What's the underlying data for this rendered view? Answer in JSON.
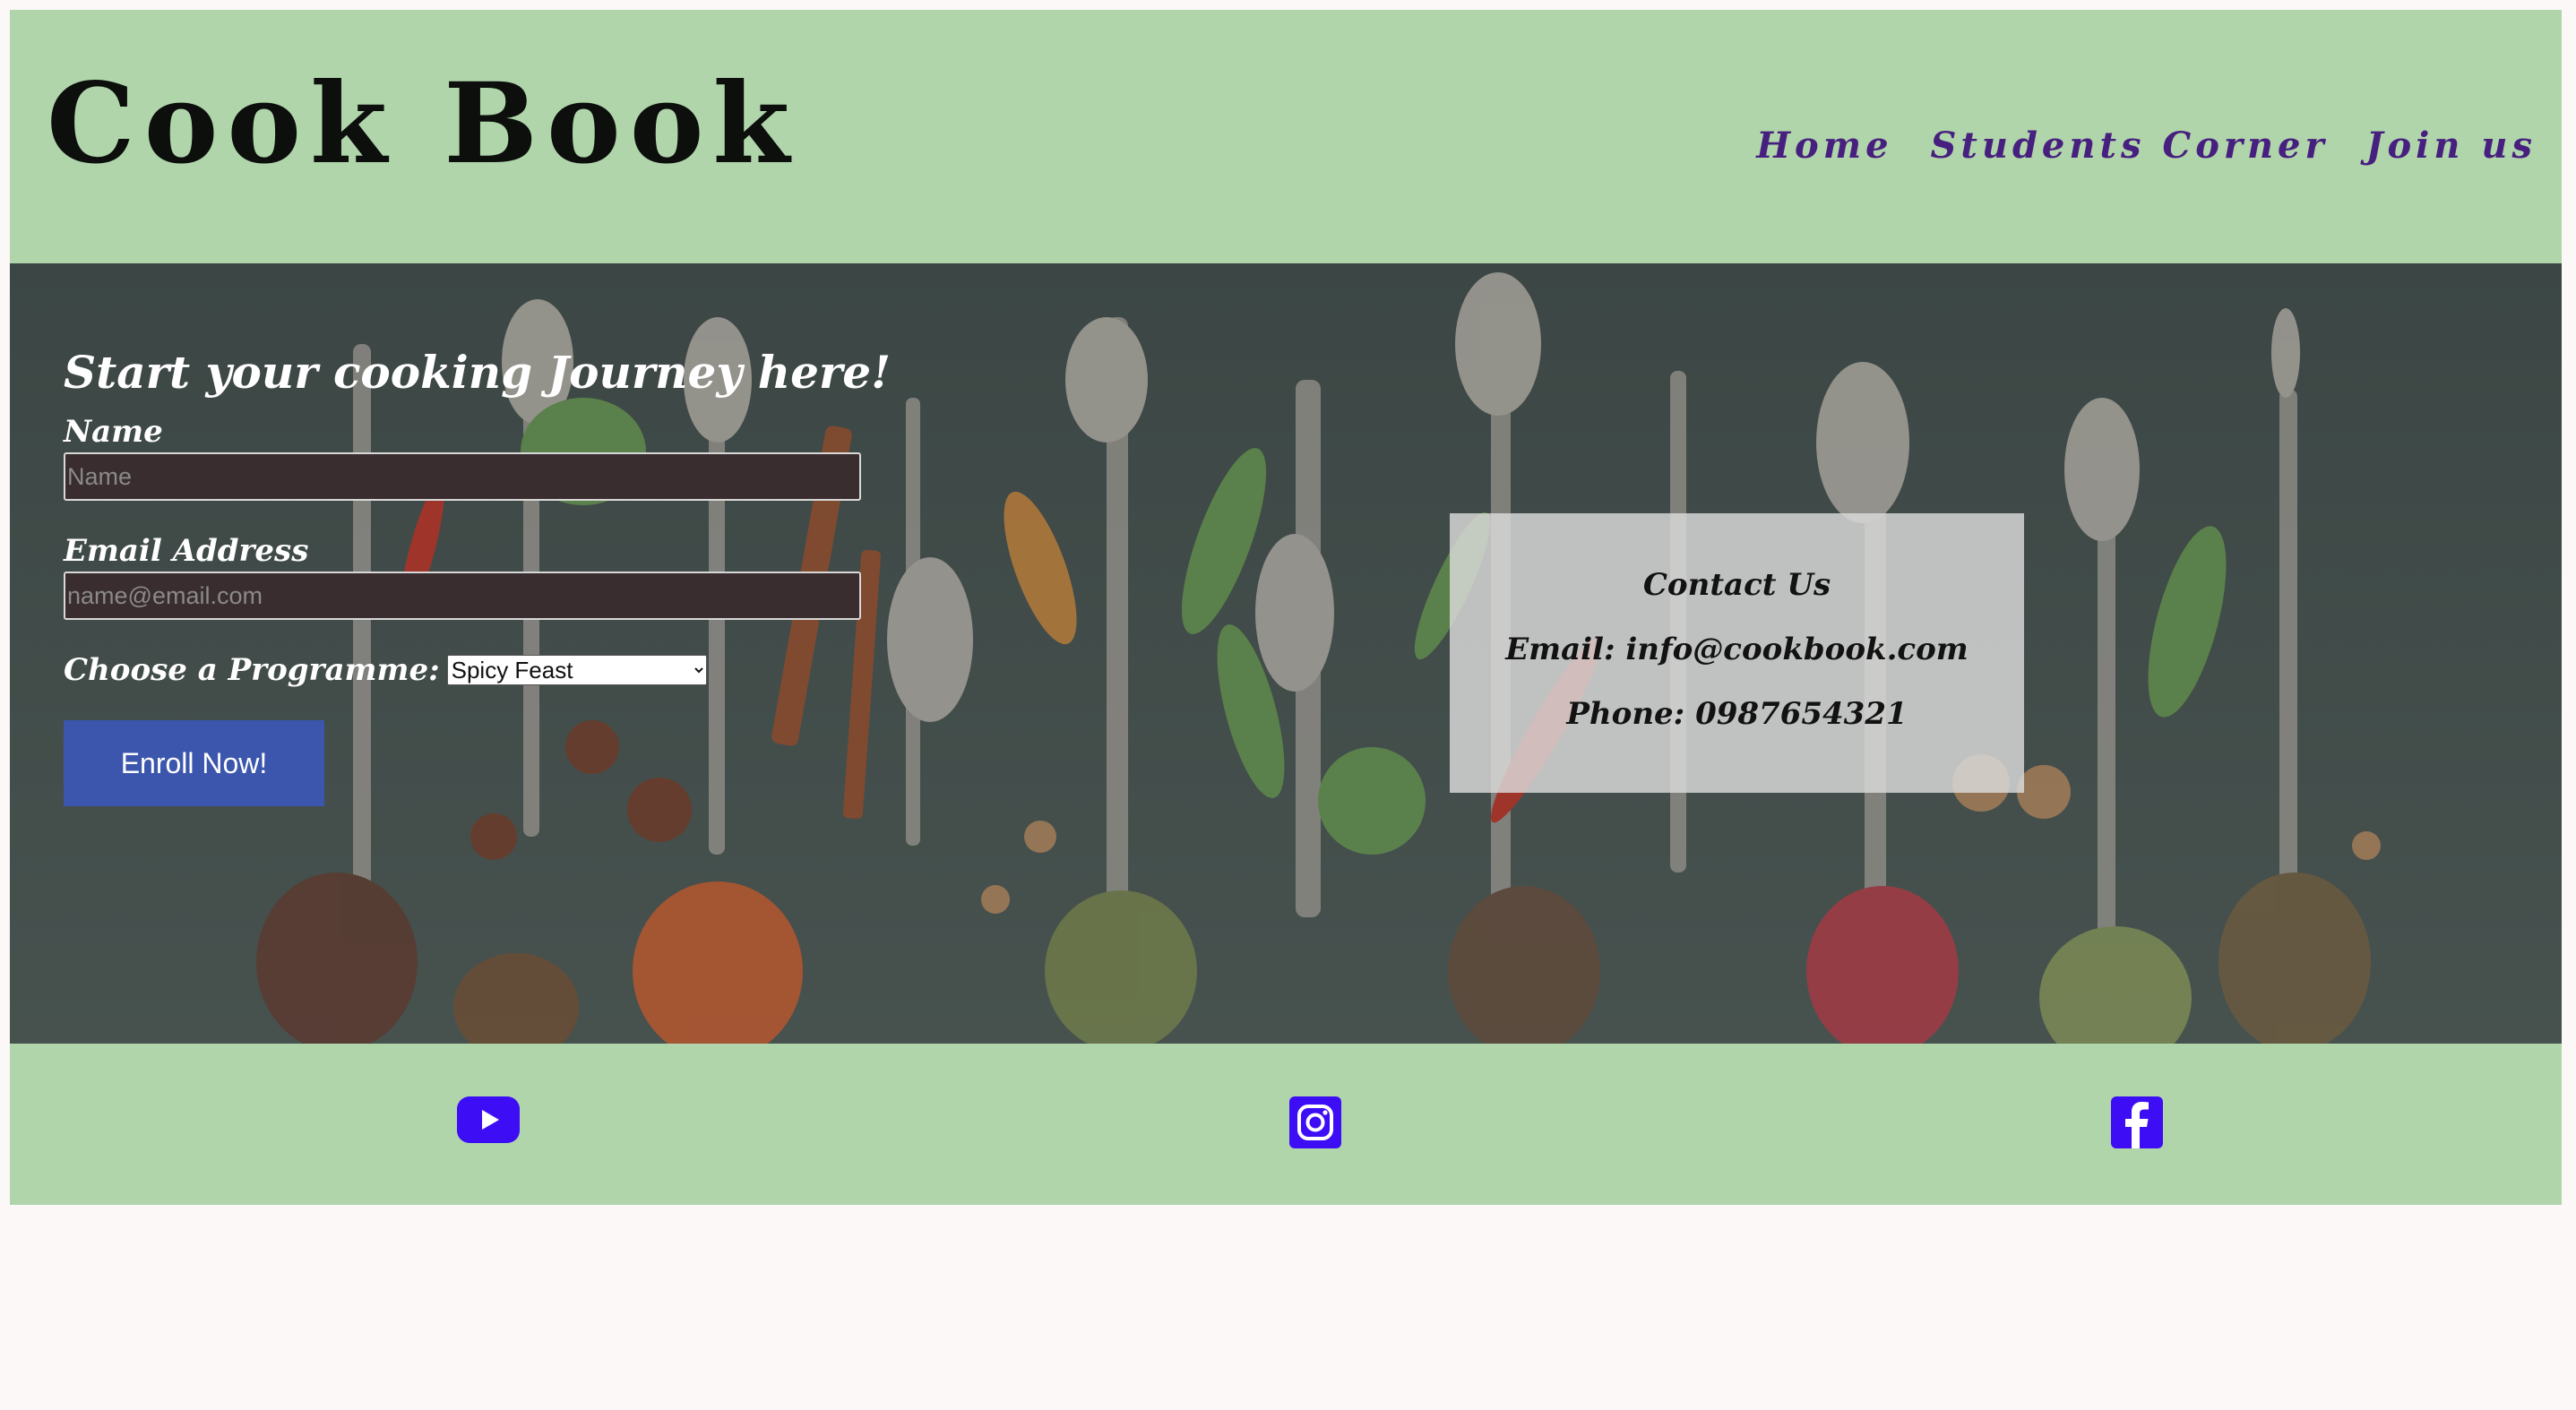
{
  "header": {
    "brand": "Cook Book",
    "nav": [
      {
        "label": "Home"
      },
      {
        "label": "Students Corner"
      },
      {
        "label": "Join us"
      }
    ]
  },
  "colors": {
    "header_bg": "#b0d5ab",
    "nav_link": "#47207f",
    "button_bg": "#3b56ac",
    "social_icon": "#3d0df5",
    "page_bg": "#fcf8f8"
  },
  "form": {
    "heading": "Start your cooking Journey here!",
    "name_label": "Name",
    "name_placeholder": "Name",
    "email_label": "Email Address",
    "email_placeholder": "name@email.com",
    "programme_label": "Choose a Programme:",
    "programme_selected": "Spicy Feast",
    "submit_label": "Enroll Now!"
  },
  "contact": {
    "title": "Contact Us",
    "email": "Email: info@cookbook.com",
    "phone": "Phone: 0987654321"
  },
  "footer": {
    "icons": [
      "youtube-icon",
      "instagram-icon",
      "facebook-icon"
    ]
  }
}
